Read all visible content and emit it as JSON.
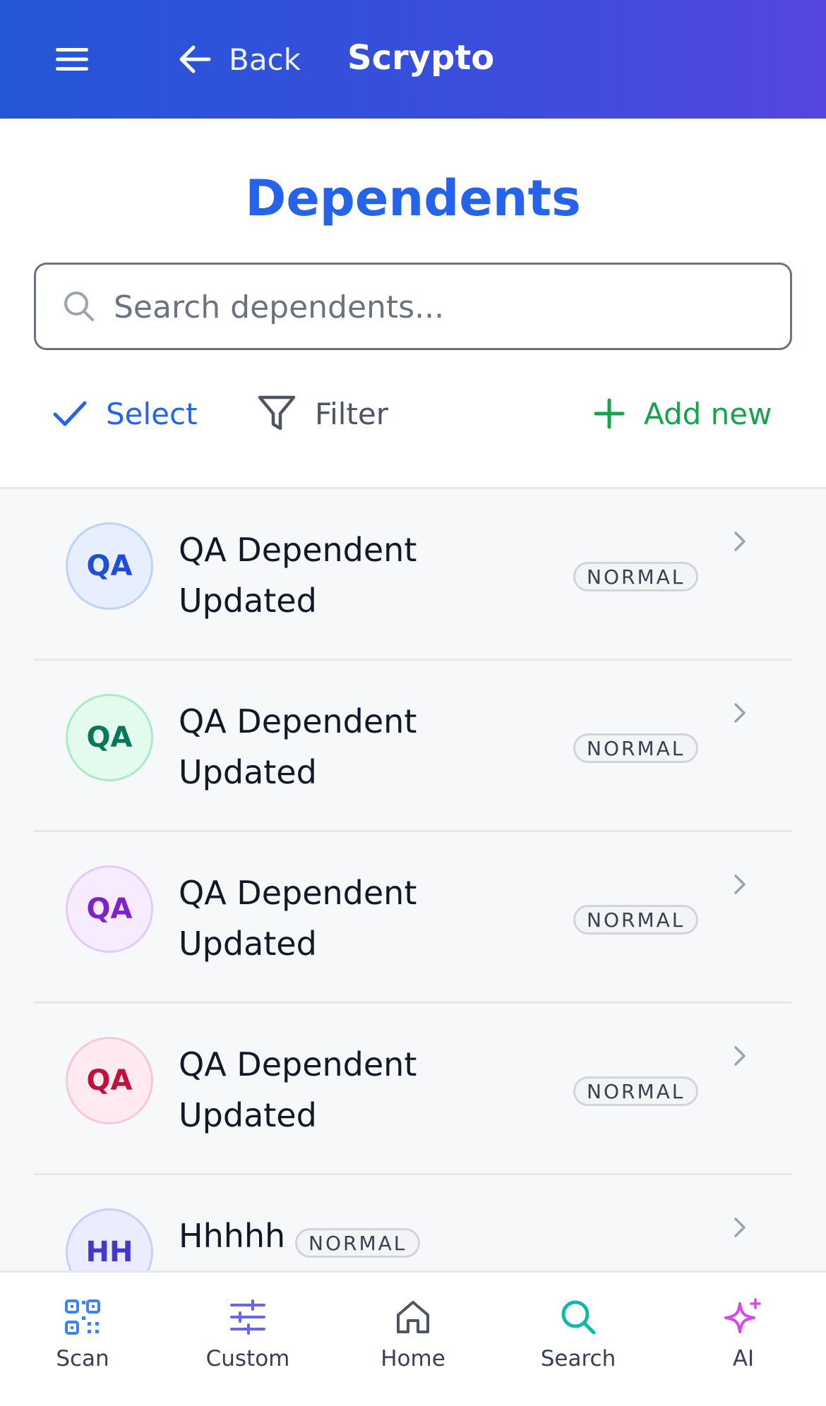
{
  "header": {
    "back_label": "Back",
    "app_title": "Scrypto"
  },
  "page": {
    "title": "Dependents"
  },
  "search": {
    "placeholder": "Search dependents..."
  },
  "actions": {
    "select_label": "Select",
    "filter_label": "Filter",
    "add_label": "Add new"
  },
  "dependents": [
    {
      "initials": "QA",
      "name": "QA Dependent Updated",
      "badge": "NORMAL",
      "bg": "#e7efff",
      "border": "#bcd3fb",
      "fg": "#1d4ed8"
    },
    {
      "initials": "QA",
      "name": "QA Dependent Updated",
      "badge": "NORMAL",
      "bg": "#e3fbee",
      "border": "#a8ebc6",
      "fg": "#047857"
    },
    {
      "initials": "QA",
      "name": "QA Dependent Updated",
      "badge": "NORMAL",
      "bg": "#f6ebff",
      "border": "#e4cbfb",
      "fg": "#7e22ce"
    },
    {
      "initials": "QA",
      "name": "QA Dependent Updated",
      "badge": "NORMAL",
      "bg": "#ffeaf2",
      "border": "#fbc6da",
      "fg": "#be123c"
    },
    {
      "initials": "HH",
      "name": "Hhhhh",
      "badge": "NORMAL",
      "bg": "#ebedff",
      "border": "#c9cffb",
      "fg": "#4338ca"
    }
  ],
  "nav": [
    {
      "label": "Scan",
      "icon": "qr-code-icon",
      "color": "#3b82f6"
    },
    {
      "label": "Custom",
      "icon": "sliders-icon",
      "color": "#6366f1"
    },
    {
      "label": "Home",
      "icon": "home-icon",
      "color": "#4b5563"
    },
    {
      "label": "Search",
      "icon": "search-icon",
      "color": "#14b8a6"
    },
    {
      "label": "AI",
      "icon": "sparkles-icon",
      "color": "#d946ef"
    }
  ]
}
